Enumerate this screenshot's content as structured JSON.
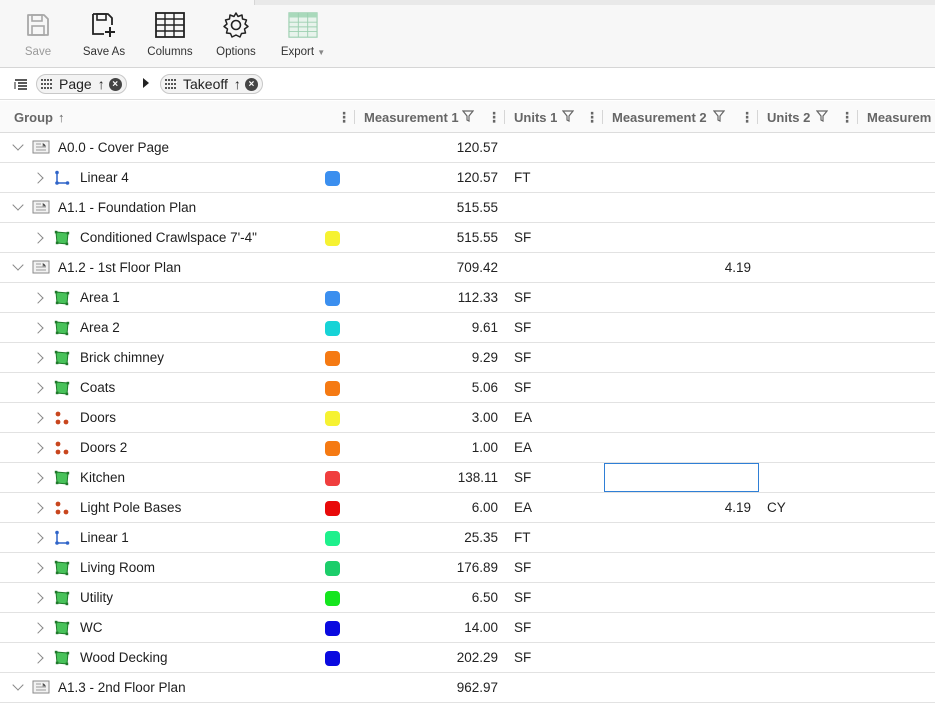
{
  "toolbar": {
    "save_label": "Save",
    "save_as_label": "Save As",
    "columns_label": "Columns",
    "options_label": "Options",
    "export_label": "Export"
  },
  "grouping": {
    "chips": [
      {
        "label": "Page"
      },
      {
        "label": "Takeoff"
      }
    ]
  },
  "header": {
    "group": "Group",
    "measurement1": "Measurement 1",
    "units1": "Units 1",
    "measurement2": "Measurement 2",
    "units2": "Units 2",
    "measurement3": "Measurem"
  },
  "rows": [
    {
      "type": "group",
      "name": "A0.0 - Cover Page",
      "m1": "120.57",
      "u1": "",
      "m2": "",
      "u2": ""
    },
    {
      "type": "item",
      "icon": "linear",
      "name": "Linear 4",
      "color": "#3b8fef",
      "m1": "120.57",
      "u1": "FT",
      "m2": "",
      "u2": ""
    },
    {
      "type": "group",
      "name": "A1.1 - Foundation Plan",
      "m1": "515.55",
      "u1": "",
      "m2": "",
      "u2": ""
    },
    {
      "type": "item",
      "icon": "area",
      "name": "Conditioned Crawlspace 7'-4\"",
      "color": "#f6f232",
      "m1": "515.55",
      "u1": "SF",
      "m2": "",
      "u2": ""
    },
    {
      "type": "group",
      "name": "A1.2 - 1st Floor Plan",
      "m1": "709.42",
      "u1": "",
      "m2": "4.19",
      "u2": ""
    },
    {
      "type": "item",
      "icon": "area",
      "name": "Area 1",
      "color": "#3b8fef",
      "m1": "112.33",
      "u1": "SF",
      "m2": "",
      "u2": ""
    },
    {
      "type": "item",
      "icon": "area",
      "name": "Area 2",
      "color": "#17d3d6",
      "m1": "9.61",
      "u1": "SF",
      "m2": "",
      "u2": ""
    },
    {
      "type": "item",
      "icon": "area",
      "name": "Brick chimney",
      "color": "#f57a13",
      "m1": "9.29",
      "u1": "SF",
      "m2": "",
      "u2": ""
    },
    {
      "type": "item",
      "icon": "area",
      "name": "Coats",
      "color": "#f57a13",
      "m1": "5.06",
      "u1": "SF",
      "m2": "",
      "u2": ""
    },
    {
      "type": "item",
      "icon": "count",
      "name": "Doors",
      "color": "#f6f232",
      "m1": "3.00",
      "u1": "EA",
      "m2": "",
      "u2": ""
    },
    {
      "type": "item",
      "icon": "count",
      "name": "Doors 2",
      "color": "#f57a13",
      "m1": "1.00",
      "u1": "EA",
      "m2": "",
      "u2": ""
    },
    {
      "type": "item",
      "icon": "area",
      "name": "Kitchen",
      "color": "#f03e3e",
      "m1": "138.11",
      "u1": "SF",
      "m2": "",
      "u2": "",
      "selected_m2": true
    },
    {
      "type": "item",
      "icon": "count",
      "name": "Light Pole Bases",
      "color": "#e80a0a",
      "m1": "6.00",
      "u1": "EA",
      "m2": "4.19",
      "u2": "CY"
    },
    {
      "type": "item",
      "icon": "linear",
      "name": "Linear 1",
      "color": "#1ef08c",
      "m1": "25.35",
      "u1": "FT",
      "m2": "",
      "u2": ""
    },
    {
      "type": "item",
      "icon": "area",
      "name": "Living Room",
      "color": "#1ccd6a",
      "m1": "176.89",
      "u1": "SF",
      "m2": "",
      "u2": ""
    },
    {
      "type": "item",
      "icon": "area",
      "name": "Utility",
      "color": "#14e51e",
      "m1": "6.50",
      "u1": "SF",
      "m2": "",
      "u2": ""
    },
    {
      "type": "item",
      "icon": "area",
      "name": "WC",
      "color": "#0a0ae0",
      "m1": "14.00",
      "u1": "SF",
      "m2": "",
      "u2": ""
    },
    {
      "type": "item",
      "icon": "area",
      "name": "Wood Decking",
      "color": "#0a0ae0",
      "m1": "202.29",
      "u1": "SF",
      "m2": "",
      "u2": ""
    },
    {
      "type": "group",
      "name": "A1.3 - 2nd Floor Plan",
      "m1": "962.97",
      "u1": "",
      "m2": "",
      "u2": ""
    }
  ]
}
